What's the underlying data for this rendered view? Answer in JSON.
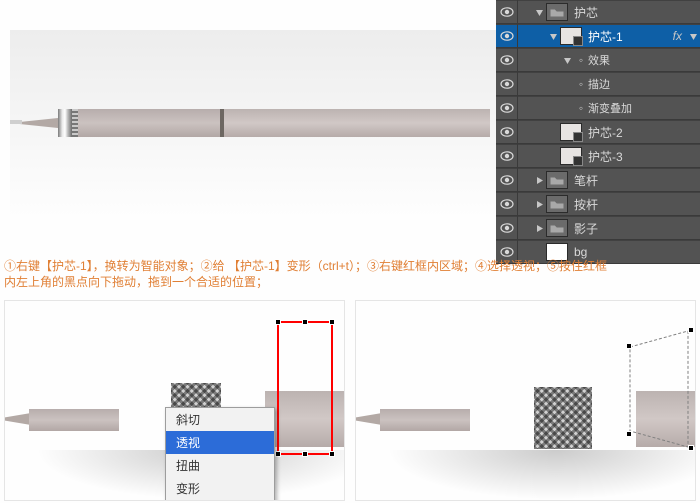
{
  "layers_panel": {
    "group_root": "护芯",
    "rows": [
      {
        "id": "root",
        "name": "护芯",
        "depth": 1,
        "thumb": "folder-open",
        "twist": "down"
      },
      {
        "id": "hx1",
        "name": "护芯-1",
        "depth": 2,
        "thumb": "smart",
        "selected": true,
        "fx": "fx",
        "twist": "down"
      },
      {
        "id": "eff",
        "name": "效果",
        "depth": 3,
        "thumb": null,
        "twist": "down",
        "bullet": true
      },
      {
        "id": "stroke",
        "name": "描边",
        "depth": 3,
        "thumb": null,
        "bullet": true
      },
      {
        "id": "grad",
        "name": "渐变叠加",
        "depth": 3,
        "thumb": null,
        "bullet": true
      },
      {
        "id": "hx2",
        "name": "护芯-2",
        "depth": 2,
        "thumb": "smart"
      },
      {
        "id": "hx3",
        "name": "护芯-3",
        "depth": 2,
        "thumb": "smart"
      },
      {
        "id": "bigan",
        "name": "笔杆",
        "depth": 1,
        "thumb": "folder",
        "twist": "right"
      },
      {
        "id": "yagan",
        "name": "按杆",
        "depth": 1,
        "thumb": "folder",
        "twist": "right"
      },
      {
        "id": "yingzi",
        "name": "影子",
        "depth": 1,
        "thumb": "folder",
        "twist": "right"
      },
      {
        "id": "bg",
        "name": "bg",
        "depth": 1,
        "thumb": "white"
      }
    ]
  },
  "instructions": {
    "line1": "①右键【护芯-1】，换转为智能对象；②给 【护芯-1】变形（ctrl+t）；③右键红框内区域；④选择透视；⑤按住红框",
    "line2": "内左上角的黑点向下拖动，拖到一个合适的位置；"
  },
  "context_menu": {
    "items": [
      {
        "label": "斜切"
      },
      {
        "label": "透视",
        "selected": true
      },
      {
        "label": "扭曲"
      },
      {
        "label": "变形"
      }
    ]
  }
}
